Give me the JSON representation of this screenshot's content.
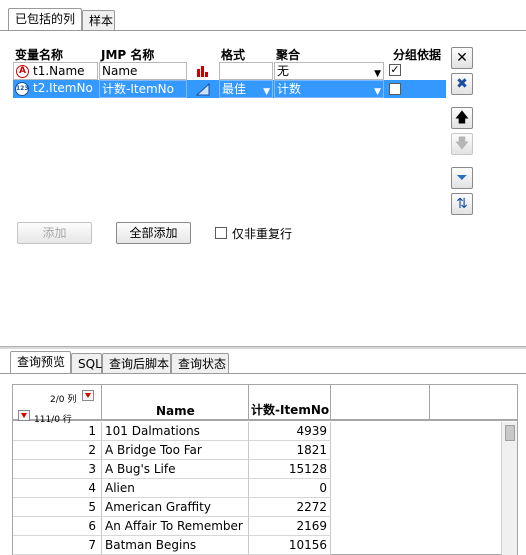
{
  "top_tabs": [
    {
      "label": "已包括的列",
      "active": true
    },
    {
      "label": "样本",
      "active": false
    }
  ],
  "columns_header": {
    "var_name": "变量名称",
    "jmp_name": "JMP 名称",
    "format": "格式",
    "aggregate": "聚合",
    "group_by": "分组依据"
  },
  "rows": [
    {
      "type_icon": "char-type-icon",
      "type_glyph": "A",
      "var_name": "t1.Name",
      "jmp_name": "Name",
      "format": "",
      "aggregate": "无",
      "group_by": true,
      "selected": false
    },
    {
      "type_icon": "numeric-type-icon",
      "type_glyph": "123",
      "var_name": "t2.ItemNo",
      "jmp_name": "计数-ItemNo",
      "format": "最佳",
      "aggregate": "计数",
      "group_by": false,
      "selected": true
    }
  ],
  "side_buttons": [
    {
      "name": "remove-button",
      "icon": "close-x-icon",
      "glyph": "✕",
      "enabled": true
    },
    {
      "name": "remove-all-button",
      "icon": "remove-all-icon",
      "glyph": "✖",
      "enabled": true
    },
    {
      "name": "move-up-button",
      "icon": "arrow-up-icon",
      "glyph": "🡅",
      "enabled": true
    },
    {
      "name": "move-down-button",
      "icon": "arrow-down-icon",
      "glyph": "🡇",
      "enabled": false
    },
    {
      "name": "filter-button",
      "icon": "filter-funnel-icon",
      "glyph": "⏷",
      "enabled": true
    },
    {
      "name": "sort-button",
      "icon": "sort-icon",
      "glyph": "⇅",
      "enabled": true
    }
  ],
  "buttons": {
    "add": "添加",
    "add_all": "全部添加",
    "unique_rows_label": "仅非重复行"
  },
  "bottom_tabs": [
    {
      "label": "查询预览",
      "active": true
    },
    {
      "label": "SQL",
      "active": false
    },
    {
      "label": "查询后脚本",
      "active": false
    },
    {
      "label": "查询状态",
      "active": false
    }
  ],
  "preview": {
    "cols_count": "2/0 列",
    "rows_count": "111/0 行",
    "headers": [
      "Name",
      "计数-ItemNo"
    ],
    "rows": [
      {
        "n": "1",
        "name": "101 Dalmations",
        "count": "4939"
      },
      {
        "n": "2",
        "name": "A Bridge Too Far",
        "count": "1821"
      },
      {
        "n": "3",
        "name": "A Bug's Life",
        "count": "15128"
      },
      {
        "n": "4",
        "name": "Alien",
        "count": "0"
      },
      {
        "n": "5",
        "name": "American Graffity",
        "count": "2272"
      },
      {
        "n": "6",
        "name": "An Affair To Remember",
        "count": "2169"
      },
      {
        "n": "7",
        "name": "Batman Begins",
        "count": "10156"
      }
    ]
  },
  "colors": {
    "selection": "#3399ff",
    "accent_red": "#d40000",
    "border": "#a6a6a6"
  }
}
